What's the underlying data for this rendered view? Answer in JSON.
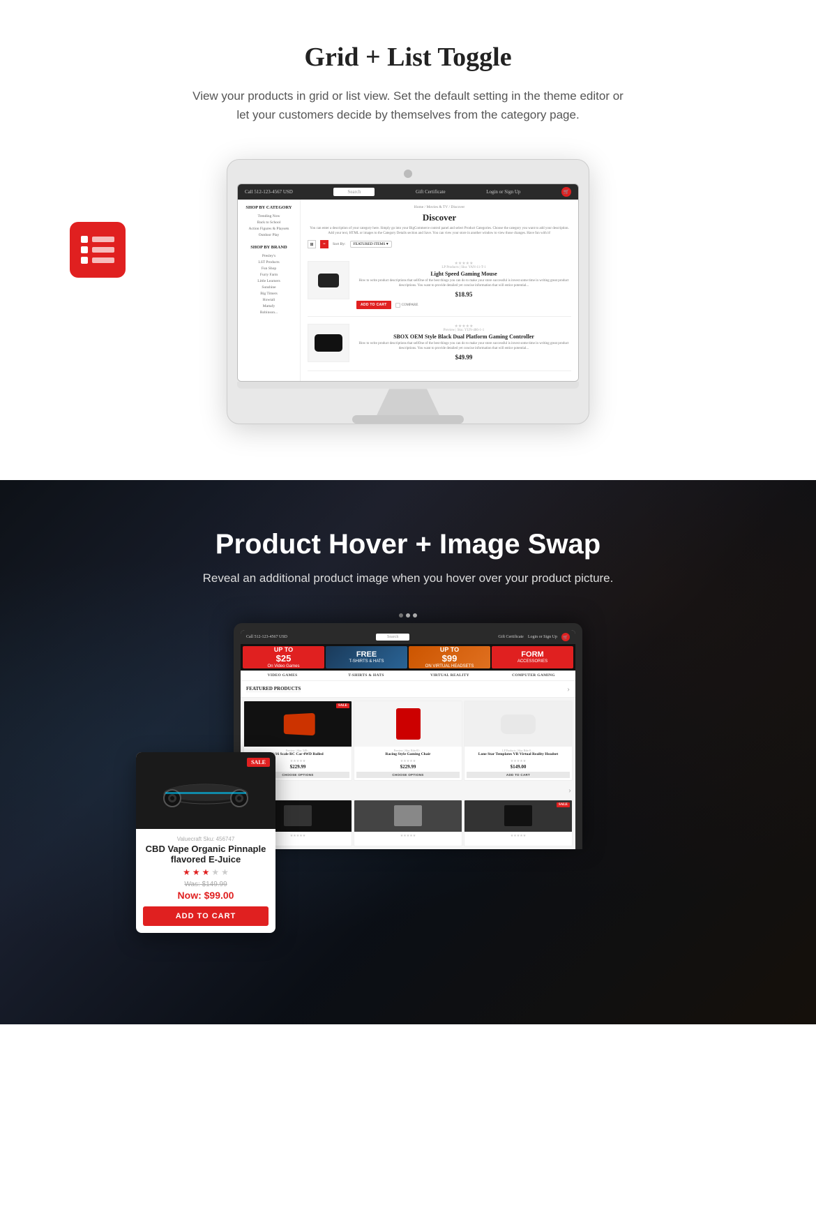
{
  "section1": {
    "title": "Grid + List Toggle",
    "subtitle": "View your products in grid or list view. Set the default setting in the theme editor or let your customers decide by themselves from the category page.",
    "store": {
      "header": {
        "phone": "Call 512-123-4567  USD",
        "search_placeholder": "Search",
        "gift_cert": "Gift Certificate",
        "login": "Login or Sign Up"
      },
      "sidebar": {
        "section1_title": "SHOP BY CATEGORY",
        "items1": [
          "Trending Now",
          "Back to School",
          "Action Figures & Playsets",
          "Outdoor Play"
        ],
        "section2_title": "SHOP BY BRAND",
        "items2": [
          "Presley's",
          "LST Products",
          "Fun Shop",
          "Furry Farm",
          "Little Learners",
          "Sunshine",
          "Big Timers",
          "Howtali",
          "Mattafy",
          "Robinson..."
        ]
      },
      "main": {
        "breadcrumb": "Home / Movies & TV / Discover",
        "page_title": "Discover",
        "description": "You can enter a description of your category here. Simply go into your BigCommerce control panel and select Product Categories. Choose the category you want to add your description. Add your text, HTML or images to the Category Details section and Save. You can view your store in another window to view those changes. Have fun with it!",
        "sort_label": "Sort By:",
        "sort_option": "FEATURED ITEMS",
        "products": [
          {
            "meta": "LP Products | Sku: YAN-11-T-1",
            "name": "Light Speed Gaming Mouse",
            "description": "How to write product descriptions that sellOne of the best things you can do to make your store successful is invest some time in writing great product descriptions. You want to provide detailed yet concise information that will entice potential...",
            "price": "$18.95",
            "type": "mouse"
          },
          {
            "meta": "Preview | Sku: YUN-486-1-1",
            "name": "SBOX OEM Style Black Dual Platform Gaming Controller",
            "description": "How to write product descriptions that sellOne of the best things you can do to make your store successful is invest some time in writing great product descriptions. You want to provide detailed yet concise information that will entice potential...",
            "price": "$49.99",
            "type": "controller"
          }
        ],
        "add_to_cart_label": "ADD TO CART",
        "compare_label": "COMPARE"
      }
    }
  },
  "section2": {
    "title": "Product Hover + Image Swap",
    "subtitle": "Reveal an additional product image when you hover over your product picture.",
    "store": {
      "header": {
        "phone": "Call 512-123-4567  USD",
        "search_placeholder": "Search",
        "gift_cert": "Gift Certificate",
        "login": "Login or Sign Up"
      },
      "banners": [
        {
          "text": "UP TO $25\nOn Video Games",
          "class": "b1"
        },
        {
          "text": "FREE\nT-SHIRTS & HATS",
          "class": "b2"
        },
        {
          "text": "UP TO $99\nON VIRTUAL HEADSETS",
          "class": "b3"
        },
        {
          "text": "FORM\nACCESSORIES",
          "class": "b4"
        }
      ],
      "nav": [
        "VIDEO GAMES",
        "T-SHIRTS & HATS",
        "VIRTUAL REALITY",
        "COMPUTER GAMING"
      ],
      "featured_header": "FEATURED PRODUCTS",
      "products_row1": [
        {
          "name": "1/16 Scale RC Car 4WD\nRolled",
          "price": "$229.99",
          "btn": "CHOOSE OPTIONS",
          "btn_type": "gray",
          "sale": true,
          "type": "rc_car"
        },
        {
          "name": "Racing Style Gaming Chair",
          "price": "$229.99",
          "btn": "CHOOSE OPTIONS",
          "btn_type": "gray",
          "sale": false,
          "type": "chair"
        },
        {
          "name": "Lone Star Templates VR Virtual Reality Headset",
          "price": "$149.00",
          "btn": "ADD TO CART",
          "btn_type": "gray",
          "sale": false,
          "type": "vr"
        }
      ],
      "products_row2": [
        {
          "type": "dark1",
          "sale": false
        },
        {
          "type": "dark2",
          "sale": false
        },
        {
          "type": "dark3",
          "sale": true
        }
      ]
    },
    "hover_card": {
      "meta": "Valuecraft  Sku: 456747",
      "name": "CBD Vape Organic Pinnaple flavored E-Juice",
      "stars": 3,
      "was_price": "Was: $149.99",
      "now_price": "Now: $99.00",
      "sale_badge": "SALE",
      "add_to_cart": "ADD TO CART"
    }
  }
}
